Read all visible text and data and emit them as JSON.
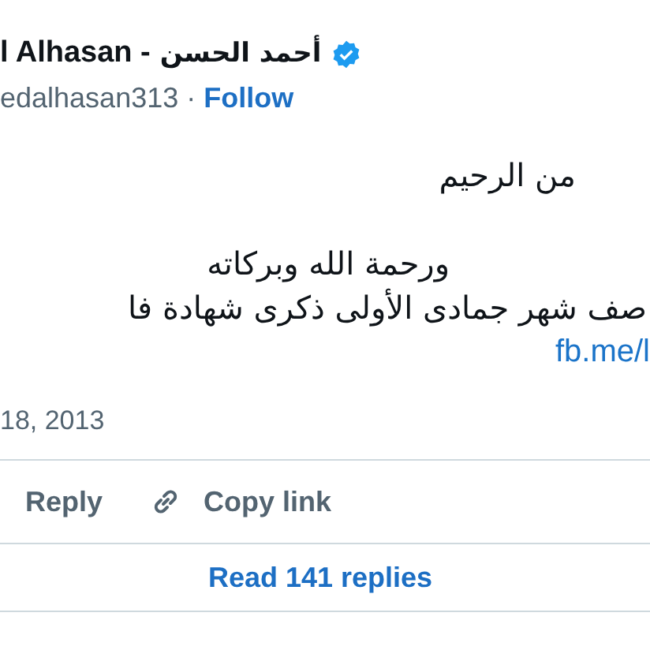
{
  "author": {
    "name_latin": "l Alhasan -",
    "name_arabic": "أحمد الحسن",
    "verified": true,
    "handle": "edalhasan313 ·",
    "follow": "Follow"
  },
  "lines": [
    {
      "text": "من الرحيم",
      "kind": "text"
    },
    {
      "text": "ورحمة الله وبركاته",
      "kind": "text"
    },
    {
      "text": "صف شهر جمادى الأولى ذكرى شهادة فا",
      "kind": "text"
    },
    {
      "text": "fb.me/l",
      "kind": "link"
    }
  ],
  "date": "18, 2013",
  "reply_button": "Reply",
  "copy_link_button": "Copy link",
  "read_replies": "Read 141 replies"
}
